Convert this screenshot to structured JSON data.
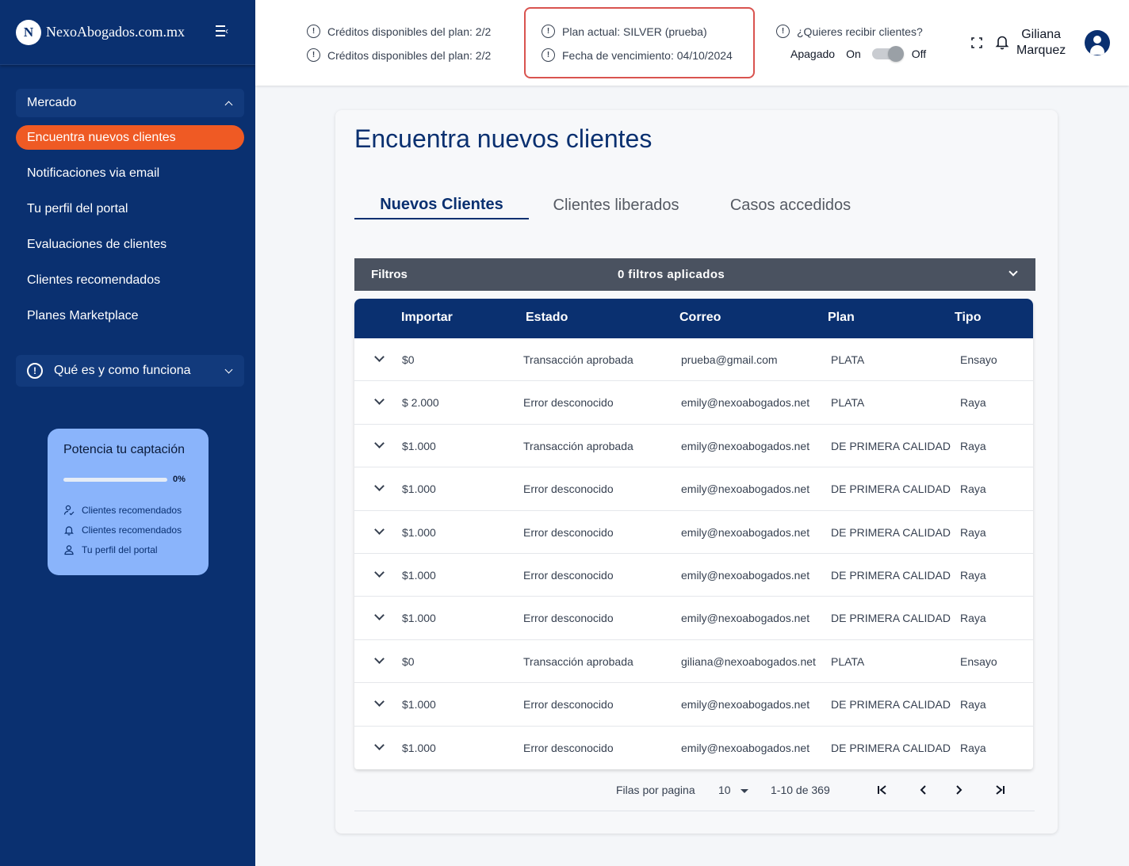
{
  "brand": {
    "logo_text": "NexoAbogados.com.mx",
    "logo_mark": "N",
    "primary": "#0a3070",
    "accent": "#ef5a24"
  },
  "sidebar": {
    "group_label": "Mercado",
    "items": [
      {
        "label": "Encuentra nuevos clientes",
        "active": true
      },
      {
        "label": "Notificaciones via email"
      },
      {
        "label": "Tu perfil del portal"
      },
      {
        "label": "Evaluaciones de clientes"
      },
      {
        "label": "Clientes recomendados"
      },
      {
        "label": "Planes Marketplace"
      }
    ],
    "help_label": "Qué es y como funciona",
    "promo": {
      "title": "Potencia tu captación",
      "progress_pct": "0%",
      "progress": 0,
      "links": [
        "Clientes recomendados",
        "Clientes recomendados",
        "Tu perfil del portal"
      ]
    }
  },
  "header": {
    "credits_1": "Créditos disponibles del plan: 2/2",
    "credits_2": "Créditos disponibles del plan: 2/2",
    "plan": "Plan actual: SILVER (prueba)",
    "expiry": "Fecha de vencimiento: 04/10/2024",
    "receive_question": "¿Quieres recibir clientes?",
    "toggle_state": "Apagado",
    "toggle_on": "On",
    "toggle_off": "Off",
    "user_first": "Giliana",
    "user_last": "Marquez"
  },
  "main": {
    "title": "Encuentra nuevos clientes",
    "tabs": [
      "Nuevos Clientes",
      "Clientes liberados",
      "Casos accedidos"
    ],
    "filters_label": "Filtros",
    "filters_count": "0 filtros aplicados"
  },
  "table": {
    "columns": [
      "Importar",
      "Estado",
      "Correo",
      "Plan",
      "Tipo"
    ],
    "rows": [
      [
        "$0",
        "Transacción aprobada",
        "prueba@gmail.com",
        "PLATA",
        "Ensayo"
      ],
      [
        "$ 2.000",
        "Error desconocido",
        "emily@nexoabogados.net",
        "PLATA",
        "Raya"
      ],
      [
        "$1.000",
        "Transacción aprobada",
        "emily@nexoabogados.net",
        "DE PRIMERA CALIDAD",
        "Raya"
      ],
      [
        "$1.000",
        "Error desconocido",
        "emily@nexoabogados.net",
        "DE PRIMERA CALIDAD",
        "Raya"
      ],
      [
        "$1.000",
        "Error desconocido",
        "emily@nexoabogados.net",
        "DE PRIMERA CALIDAD",
        "Raya"
      ],
      [
        "$1.000",
        "Error desconocido",
        "emily@nexoabogados.net",
        "DE PRIMERA CALIDAD",
        "Raya"
      ],
      [
        "$1.000",
        "Error desconocido",
        "emily@nexoabogados.net",
        "DE PRIMERA CALIDAD",
        "Raya"
      ],
      [
        "$0",
        "Transacción aprobada",
        "giliana@nexoabogados.net",
        "PLATA",
        "Ensayo"
      ],
      [
        "$1.000",
        "Error desconocido",
        "emily@nexoabogados.net",
        "DE PRIMERA CALIDAD",
        "Raya"
      ],
      [
        "$1.000",
        "Error desconocido",
        "emily@nexoabogados.net",
        "DE PRIMERA CALIDAD",
        "Raya"
      ]
    ]
  },
  "pagination": {
    "rows_per_page_label": "Filas por pagina",
    "rows_per_page": "10",
    "range": "1-10 de 369"
  }
}
